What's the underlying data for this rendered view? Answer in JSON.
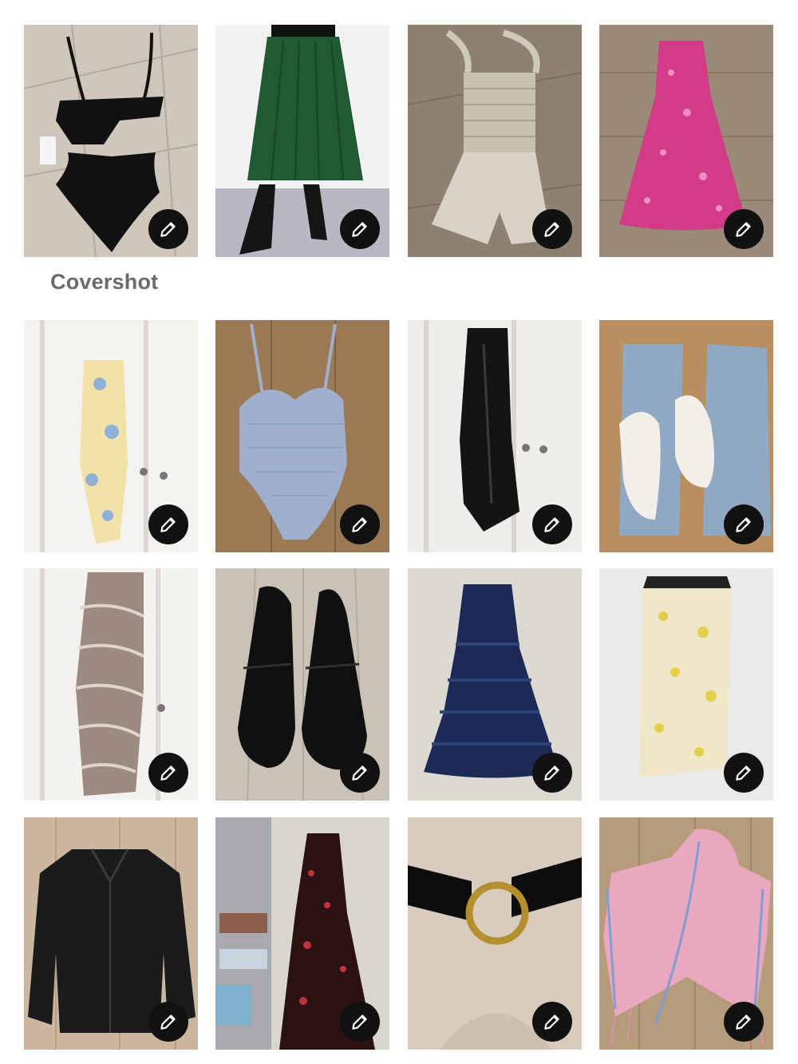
{
  "cover_label": "Covershot",
  "items": [
    {
      "id": "black-cutout-swimsuit",
      "bg": "#cfc7bb",
      "color": "#111111"
    },
    {
      "id": "green-pleated-skirt",
      "bg": "#f2f2f2",
      "color": "#1f5a33"
    },
    {
      "id": "smocked-romper",
      "bg": "#8e8172",
      "color": "#d8d2c6"
    },
    {
      "id": "pink-floral-dress",
      "bg": "#9a8b78",
      "color": "#d23c87"
    },
    {
      "id": "yellow-floral-slip-dress",
      "bg": "#f4f3f0",
      "color": "#f1e3a8"
    },
    {
      "id": "gingham-swimsuit",
      "bg": "#9a7a55",
      "color": "#9fb0cf"
    },
    {
      "id": "black-satin-slip-dress",
      "bg": "#efeeea",
      "color": "#141414"
    },
    {
      "id": "jeans-and-white-bikini",
      "bg": "#b98f60",
      "color": "#8fa8c4"
    },
    {
      "id": "zebra-print-slip-dress",
      "bg": "#f3f2ef",
      "color": "#9c8b80"
    },
    {
      "id": "black-suede-loafers",
      "bg": "#c9c2b6",
      "color": "#101010"
    },
    {
      "id": "navy-tiered-ruffle-dress",
      "bg": "#dcd8d2",
      "color": "#1c2a55"
    },
    {
      "id": "floral-satin-skirt",
      "bg": "#eaeaea",
      "color": "#efe7c8"
    },
    {
      "id": "black-denim-jacket",
      "bg": "#cbb79d",
      "color": "#1b1b1d"
    },
    {
      "id": "black-floral-maxi-dress",
      "bg": "#d9d6d0",
      "color": "#2a1212"
    },
    {
      "id": "black-ring-belt",
      "bg": "#d8ccbf",
      "color": "#0d0d0d"
    },
    {
      "id": "pink-fringe-poncho",
      "bg": "#b79c7b",
      "color": "#e9a7c0"
    }
  ]
}
